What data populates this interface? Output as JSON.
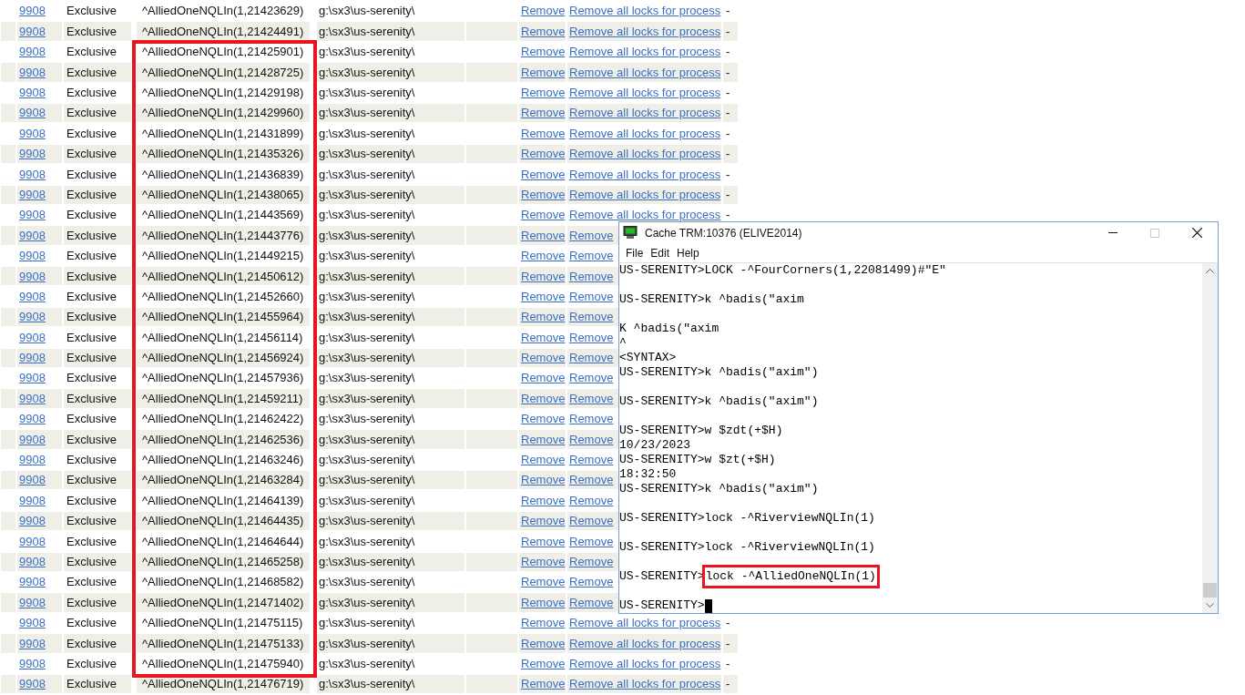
{
  "table": {
    "rows": [
      {
        "process": "9908",
        "mode": "Exclusive",
        "lock_reference": "^AlliedOneNQLIn(1,21423629)",
        "directory": "g:\\sx3\\us-serenity\\",
        "remove": "Remove",
        "remove_all": "Remove all locks for process",
        "column_9": "-"
      },
      {
        "process": "9908",
        "mode": "Exclusive",
        "lock_reference": "^AlliedOneNQLIn(1,21424491)",
        "directory": "g:\\sx3\\us-serenity\\",
        "remove": "Remove",
        "remove_all": "Remove all locks for process",
        "column_9": "-"
      },
      {
        "process": "9908",
        "mode": "Exclusive",
        "lock_reference": "^AlliedOneNQLIn(1,21425901)",
        "directory": "g:\\sx3\\us-serenity\\",
        "remove": "Remove",
        "remove_all": "Remove all locks for process",
        "column_9": "-"
      },
      {
        "process": "9908",
        "mode": "Exclusive",
        "lock_reference": "^AlliedOneNQLIn(1,21428725)",
        "directory": "g:\\sx3\\us-serenity\\",
        "remove": "Remove",
        "remove_all": "Remove all locks for process",
        "column_9": "-"
      },
      {
        "process": "9908",
        "mode": "Exclusive",
        "lock_reference": "^AlliedOneNQLIn(1,21429198)",
        "directory": "g:\\sx3\\us-serenity\\",
        "remove": "Remove",
        "remove_all": "Remove all locks for process",
        "column_9": "-"
      },
      {
        "process": "9908",
        "mode": "Exclusive",
        "lock_reference": "^AlliedOneNQLIn(1,21429960)",
        "directory": "g:\\sx3\\us-serenity\\",
        "remove": "Remove",
        "remove_all": "Remove all locks for process",
        "column_9": "-"
      },
      {
        "process": "9908",
        "mode": "Exclusive",
        "lock_reference": "^AlliedOneNQLIn(1,21431899)",
        "directory": "g:\\sx3\\us-serenity\\",
        "remove": "Remove",
        "remove_all": "Remove all locks for process",
        "column_9": "-"
      },
      {
        "process": "9908",
        "mode": "Exclusive",
        "lock_reference": "^AlliedOneNQLIn(1,21435326)",
        "directory": "g:\\sx3\\us-serenity\\",
        "remove": "Remove",
        "remove_all": "Remove all locks for process",
        "column_9": "-"
      },
      {
        "process": "9908",
        "mode": "Exclusive",
        "lock_reference": "^AlliedOneNQLIn(1,21436839)",
        "directory": "g:\\sx3\\us-serenity\\",
        "remove": "Remove",
        "remove_all": "Remove all locks for process",
        "column_9": "-"
      },
      {
        "process": "9908",
        "mode": "Exclusive",
        "lock_reference": "^AlliedOneNQLIn(1,21438065)",
        "directory": "g:\\sx3\\us-serenity\\",
        "remove": "Remove",
        "remove_all": "Remove all locks for process",
        "column_9": "-"
      },
      {
        "process": "9908",
        "mode": "Exclusive",
        "lock_reference": "^AlliedOneNQLIn(1,21443569)",
        "directory": "g:\\sx3\\us-serenity\\",
        "remove": "Remove",
        "remove_all": "Remove all locks for process",
        "column_9": "-"
      },
      {
        "process": "9908",
        "mode": "Exclusive",
        "lock_reference": "^AlliedOneNQLIn(1,21443776)",
        "directory": "g:\\sx3\\us-serenity\\",
        "remove": "Remove",
        "remove_all": "Remove"
      },
      {
        "process": "9908",
        "mode": "Exclusive",
        "lock_reference": "^AlliedOneNQLIn(1,21449215)",
        "directory": "g:\\sx3\\us-serenity\\",
        "remove": "Remove",
        "remove_all": "Remove"
      },
      {
        "process": "9908",
        "mode": "Exclusive",
        "lock_reference": "^AlliedOneNQLIn(1,21450612)",
        "directory": "g:\\sx3\\us-serenity\\",
        "remove": "Remove",
        "remove_all": "Remove"
      },
      {
        "process": "9908",
        "mode": "Exclusive",
        "lock_reference": "^AlliedOneNQLIn(1,21452660)",
        "directory": "g:\\sx3\\us-serenity\\",
        "remove": "Remove",
        "remove_all": "Remove"
      },
      {
        "process": "9908",
        "mode": "Exclusive",
        "lock_reference": "^AlliedOneNQLIn(1,21455964)",
        "directory": "g:\\sx3\\us-serenity\\",
        "remove": "Remove",
        "remove_all": "Remove"
      },
      {
        "process": "9908",
        "mode": "Exclusive",
        "lock_reference": "^AlliedOneNQLIn(1,21456114)",
        "directory": "g:\\sx3\\us-serenity\\",
        "remove": "Remove",
        "remove_all": "Remove"
      },
      {
        "process": "9908",
        "mode": "Exclusive",
        "lock_reference": "^AlliedOneNQLIn(1,21456924)",
        "directory": "g:\\sx3\\us-serenity\\",
        "remove": "Remove",
        "remove_all": "Remove"
      },
      {
        "process": "9908",
        "mode": "Exclusive",
        "lock_reference": "^AlliedOneNQLIn(1,21457936)",
        "directory": "g:\\sx3\\us-serenity\\",
        "remove": "Remove",
        "remove_all": "Remove"
      },
      {
        "process": "9908",
        "mode": "Exclusive",
        "lock_reference": "^AlliedOneNQLIn(1,21459211)",
        "directory": "g:\\sx3\\us-serenity\\",
        "remove": "Remove",
        "remove_all": "Remove"
      },
      {
        "process": "9908",
        "mode": "Exclusive",
        "lock_reference": "^AlliedOneNQLIn(1,21462422)",
        "directory": "g:\\sx3\\us-serenity\\",
        "remove": "Remove",
        "remove_all": "Remove"
      },
      {
        "process": "9908",
        "mode": "Exclusive",
        "lock_reference": "^AlliedOneNQLIn(1,21462536)",
        "directory": "g:\\sx3\\us-serenity\\",
        "remove": "Remove",
        "remove_all": "Remove"
      },
      {
        "process": "9908",
        "mode": "Exclusive",
        "lock_reference": "^AlliedOneNQLIn(1,21463246)",
        "directory": "g:\\sx3\\us-serenity\\",
        "remove": "Remove",
        "remove_all": "Remove"
      },
      {
        "process": "9908",
        "mode": "Exclusive",
        "lock_reference": "^AlliedOneNQLIn(1,21463284)",
        "directory": "g:\\sx3\\us-serenity\\",
        "remove": "Remove",
        "remove_all": "Remove"
      },
      {
        "process": "9908",
        "mode": "Exclusive",
        "lock_reference": "^AlliedOneNQLIn(1,21464139)",
        "directory": "g:\\sx3\\us-serenity\\",
        "remove": "Remove",
        "remove_all": "Remove"
      },
      {
        "process": "9908",
        "mode": "Exclusive",
        "lock_reference": "^AlliedOneNQLIn(1,21464435)",
        "directory": "g:\\sx3\\us-serenity\\",
        "remove": "Remove",
        "remove_all": "Remove"
      },
      {
        "process": "9908",
        "mode": "Exclusive",
        "lock_reference": "^AlliedOneNQLIn(1,21464644)",
        "directory": "g:\\sx3\\us-serenity\\",
        "remove": "Remove",
        "remove_all": "Remove"
      },
      {
        "process": "9908",
        "mode": "Exclusive",
        "lock_reference": "^AlliedOneNQLIn(1,21465258)",
        "directory": "g:\\sx3\\us-serenity\\",
        "remove": "Remove",
        "remove_all": "Remove"
      },
      {
        "process": "9908",
        "mode": "Exclusive",
        "lock_reference": "^AlliedOneNQLIn(1,21468582)",
        "directory": "g:\\sx3\\us-serenity\\",
        "remove": "Remove",
        "remove_all": "Remove"
      },
      {
        "process": "9908",
        "mode": "Exclusive",
        "lock_reference": "^AlliedOneNQLIn(1,21471402)",
        "directory": "g:\\sx3\\us-serenity\\",
        "remove": "Remove",
        "remove_all": "Remove"
      },
      {
        "process": "9908",
        "mode": "Exclusive",
        "lock_reference": "^AlliedOneNQLIn(1,21475115)",
        "directory": "g:\\sx3\\us-serenity\\",
        "remove": "Remove",
        "remove_all": "Remove all locks for process",
        "column_9": "-"
      },
      {
        "process": "9908",
        "mode": "Exclusive",
        "lock_reference": "^AlliedOneNQLIn(1,21475133)",
        "directory": "g:\\sx3\\us-serenity\\",
        "remove": "Remove",
        "remove_all": "Remove all locks for process",
        "column_9": "-"
      },
      {
        "process": "9908",
        "mode": "Exclusive",
        "lock_reference": "^AlliedOneNQLIn(1,21475940)",
        "directory": "g:\\sx3\\us-serenity\\",
        "remove": "Remove",
        "remove_all": "Remove all locks for process",
        "column_9": "-"
      },
      {
        "process": "9908",
        "mode": "Exclusive",
        "lock_reference": "^AlliedOneNQLIn(1,21476719)",
        "directory": "g:\\sx3\\us-serenity\\",
        "remove": "Remove",
        "remove_all": "Remove all locks for process",
        "column_9": "-"
      }
    ]
  },
  "terminal": {
    "title": "Cache TRM:10376 (ELIVE2014)",
    "menu": [
      "File",
      "Edit",
      "Help"
    ],
    "lines": [
      {
        "kind": "line",
        "text": "US-SERENITY>LOCK -^FourCorners(1,22081499)#\"E\""
      },
      {
        "kind": "blank"
      },
      {
        "kind": "line",
        "text": "US-SERENITY>k ^badis(\"axim"
      },
      {
        "kind": "blank"
      },
      {
        "kind": "line",
        "text": "K ^badis(\"axim"
      },
      {
        "kind": "line",
        "text": "^"
      },
      {
        "kind": "line",
        "text": "<SYNTAX>"
      },
      {
        "kind": "line",
        "text": "US-SERENITY>k ^badis(\"axim\")"
      },
      {
        "kind": "blank"
      },
      {
        "kind": "line",
        "text": "US-SERENITY>k ^badis(\"axim\")"
      },
      {
        "kind": "blank"
      },
      {
        "kind": "line",
        "text": "US-SERENITY>w $zdt(+$H)"
      },
      {
        "kind": "line",
        "text": "10/23/2023"
      },
      {
        "kind": "line",
        "text": "US-SERENITY>w $zt(+$H)"
      },
      {
        "kind": "line",
        "text": "18:32:50"
      },
      {
        "kind": "line",
        "text": "US-SERENITY>k ^badis(\"axim\")"
      },
      {
        "kind": "blank"
      },
      {
        "kind": "line",
        "text": "US-SERENITY>lock -^RiverviewNQLIn(1)"
      },
      {
        "kind": "blank"
      },
      {
        "kind": "line",
        "text": "US-SERENITY>lock -^RiverviewNQLIn(1)"
      },
      {
        "kind": "blank"
      },
      {
        "kind": "highlighted",
        "prompt": "US-SERENITY>",
        "text": "lock -^AlliedOneNQLIn(1)"
      },
      {
        "kind": "blank"
      },
      {
        "kind": "cursor",
        "text": "US-SERENITY>"
      }
    ]
  }
}
